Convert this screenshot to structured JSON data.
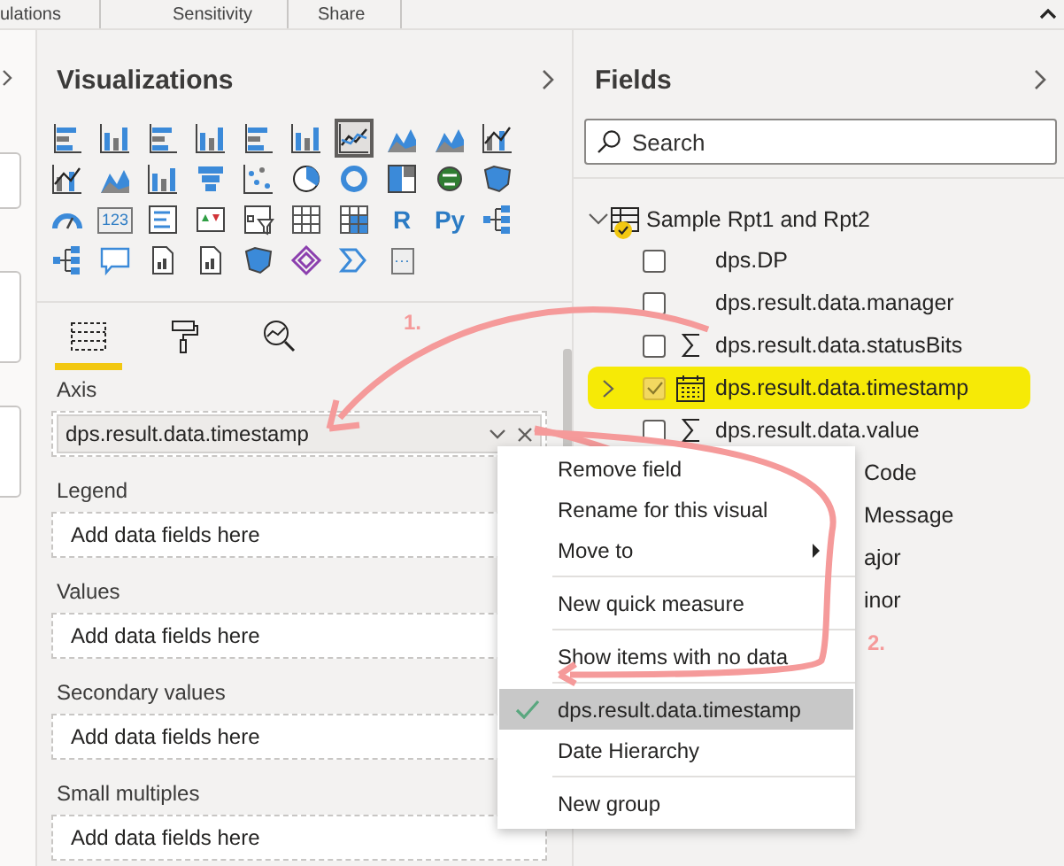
{
  "ribbon": {
    "tabs": [
      "ulations",
      "Sensitivity",
      "Share"
    ]
  },
  "visualizations": {
    "title": "Visualizations",
    "visual_types": [
      {
        "selected": false
      },
      {
        "selected": false
      },
      {
        "selected": false
      },
      {
        "selected": false
      },
      {
        "selected": false
      },
      {
        "selected": false
      },
      {
        "selected": true
      },
      {
        "selected": false
      },
      {
        "selected": false
      },
      {
        "selected": false
      },
      {
        "selected": false
      },
      {
        "selected": false
      },
      {
        "selected": false
      },
      {
        "selected": false
      },
      {
        "selected": false
      },
      {
        "selected": false
      },
      {
        "selected": false
      },
      {
        "selected": false
      },
      {
        "selected": false
      },
      {
        "selected": false
      },
      {
        "selected": false
      },
      {
        "selected": false,
        "glyph": "123"
      },
      {
        "selected": false
      },
      {
        "selected": false
      },
      {
        "selected": false
      },
      {
        "selected": false
      },
      {
        "selected": false
      },
      {
        "selected": false,
        "glyph": "R"
      },
      {
        "selected": false,
        "glyph": "Py"
      },
      {
        "selected": false
      },
      {
        "selected": false
      },
      {
        "selected": false
      },
      {
        "selected": false
      },
      {
        "selected": false
      },
      {
        "selected": false
      },
      {
        "selected": false
      },
      {
        "selected": false
      },
      {
        "selected": false,
        "glyph": "···"
      }
    ],
    "pane_tabs": [
      {
        "selected": true
      },
      {
        "selected": false
      },
      {
        "selected": false
      }
    ],
    "wells": [
      {
        "label": "Axis",
        "value": "dps.result.data.timestamp"
      },
      {
        "label": "Legend",
        "placeholder": "Add data fields here"
      },
      {
        "label": "Values",
        "placeholder": "Add data fields here"
      },
      {
        "label": "Secondary values",
        "placeholder": "Add data fields here"
      },
      {
        "label": "Small multiples",
        "placeholder": "Add data fields here"
      }
    ]
  },
  "fields": {
    "title": "Fields",
    "search": {
      "placeholder": "Search"
    },
    "table": {
      "name": "Sample Rpt1 and Rpt2",
      "expanded": true,
      "has_checked": true,
      "children": [
        {
          "kind": "field",
          "name": "dps.DP",
          "checked": false,
          "highlighted": false
        },
        {
          "kind": "field",
          "name": "dps.result.data.manager",
          "checked": false,
          "highlighted": false
        },
        {
          "kind": "measure",
          "name": "dps.result.data.statusBits",
          "checked": false,
          "highlighted": false
        },
        {
          "kind": "date",
          "name": "dps.result.data.timestamp",
          "checked": true,
          "highlighted": true,
          "expanded": false
        },
        {
          "kind": "measure",
          "name": "dps.result.data.value",
          "checked": false,
          "highlighted": false
        },
        {
          "kind": "partial",
          "name": "Code"
        },
        {
          "kind": "partial",
          "name": "Message"
        },
        {
          "kind": "partial",
          "name": "ajor"
        },
        {
          "kind": "partial",
          "name": "inor"
        }
      ]
    }
  },
  "context_menu": {
    "groups": [
      [
        {
          "kind": "item",
          "label": "Remove field"
        },
        {
          "kind": "item",
          "label": "Rename for this visual"
        },
        {
          "kind": "submenu",
          "label": "Move to"
        }
      ],
      [
        {
          "kind": "item",
          "label": "New quick measure"
        }
      ],
      [
        {
          "kind": "item",
          "label": "Show items with no data"
        }
      ],
      [
        {
          "kind": "option",
          "label": "dps.result.data.timestamp",
          "checked": true
        },
        {
          "kind": "option",
          "label": "Date Hierarchy",
          "checked": false
        }
      ],
      [
        {
          "kind": "item",
          "label": "New group"
        }
      ]
    ]
  },
  "annotations": [
    {
      "label": "1."
    },
    {
      "label": "2."
    }
  ]
}
